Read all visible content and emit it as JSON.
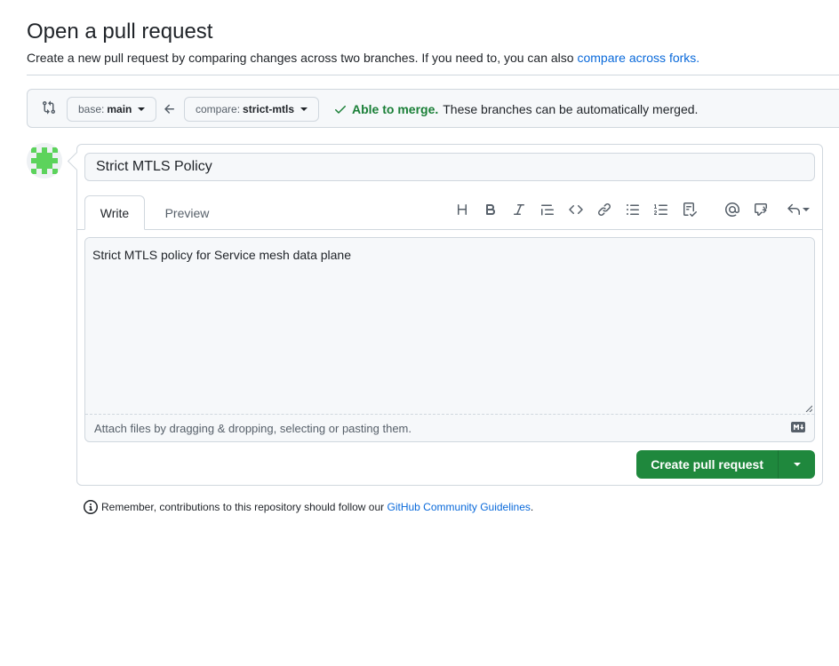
{
  "page": {
    "title": "Open a pull request",
    "subtitle_text": "Create a new pull request by comparing changes across two branches. If you need to, you can also",
    "subtitle_link": "compare across forks."
  },
  "compare_bar": {
    "base_label": "base:",
    "base_value": "main",
    "compare_label": "compare:",
    "compare_value": "strict-mtls",
    "merge_status": "Able to merge.",
    "merge_message": "These branches can be automatically merged.",
    "merge_color": "#1a7f37"
  },
  "form": {
    "title_value": "Strict MTLS Policy",
    "tabs": [
      "Write",
      "Preview"
    ],
    "active_tab": "Write",
    "body_value": "Strict MTLS policy for Service mesh data plane",
    "attach_text": "Attach files by dragging & dropping, selecting or pasting them.",
    "toolbar_icons": [
      "heading-icon",
      "bold-icon",
      "italic-icon",
      "quote-icon",
      "code-icon",
      "link-icon",
      "unordered-list-icon",
      "ordered-list-icon",
      "tasklist-icon",
      "mention-icon",
      "cross-reference-icon",
      "reply-icon"
    ],
    "submit_label": "Create pull request",
    "submit_color": "#1f883d"
  },
  "footer": {
    "guidelines_text": "Remember, contributions to this repository should follow our",
    "guidelines_link": "GitHub Community Guidelines",
    "guidelines_end": "."
  }
}
